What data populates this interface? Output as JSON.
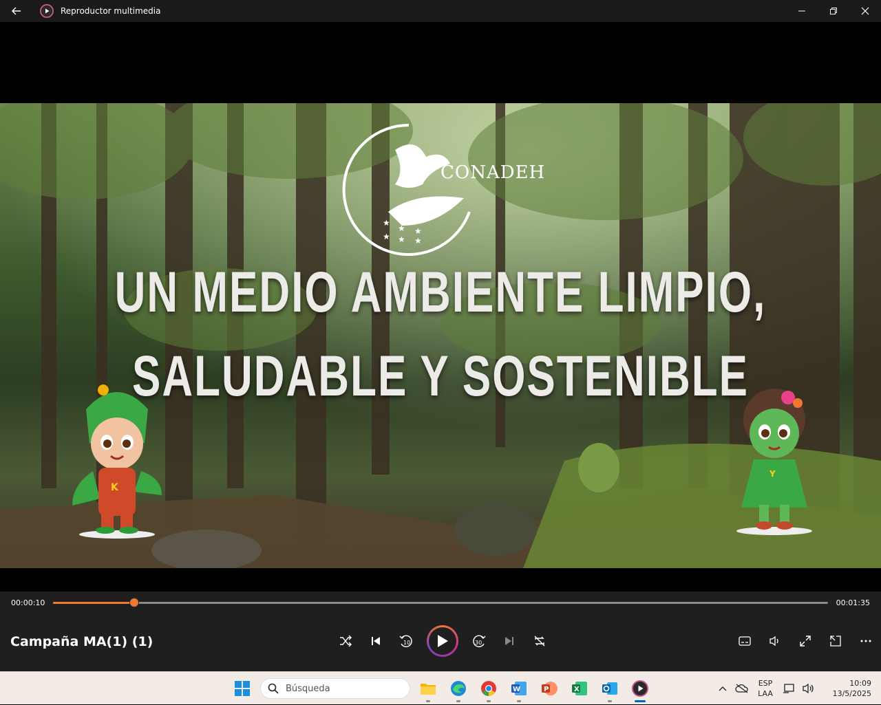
{
  "window": {
    "title": "Reproductor multimedia"
  },
  "video": {
    "logo_text": "CONADEH",
    "headline_line1": "UN MEDIO AMBIENTE LIMPIO,",
    "headline_line2": "SALUDABLE Y SOSTENIBLE"
  },
  "player": {
    "current_time": "00:00:10",
    "total_time": "00:01:35",
    "progress": 0.105,
    "media_title": "Campaña MA(1) (1)",
    "skip_back_seconds": "10",
    "skip_forward_seconds": "30",
    "accent_color": "#f07830"
  },
  "taskbar": {
    "search_placeholder": "Búsqueda",
    "language_line1": "ESP",
    "language_line2": "LAA",
    "time": "10:09",
    "date": "13/5/2025"
  }
}
